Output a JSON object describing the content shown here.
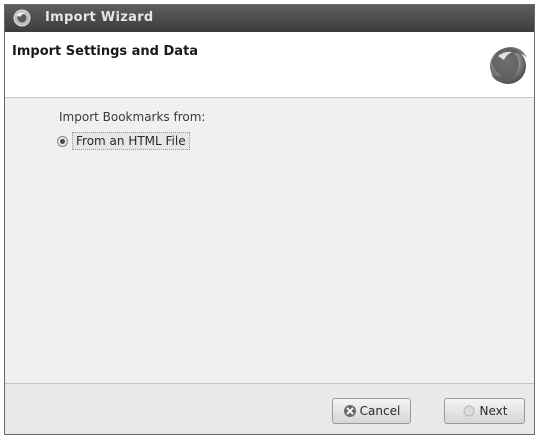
{
  "window": {
    "title": "Import Wizard",
    "app_icon": "firefox-icon"
  },
  "header": {
    "title": "Import Settings and Data",
    "logo": "firefox-logo"
  },
  "content": {
    "section_label": "Import Bookmarks from:",
    "options": [
      {
        "label": "From an HTML File",
        "selected": true
      }
    ]
  },
  "footer": {
    "cancel_label": "Cancel",
    "cancel_icon": "cancel-icon",
    "next_label": "Next",
    "next_icon": "next-icon"
  }
}
